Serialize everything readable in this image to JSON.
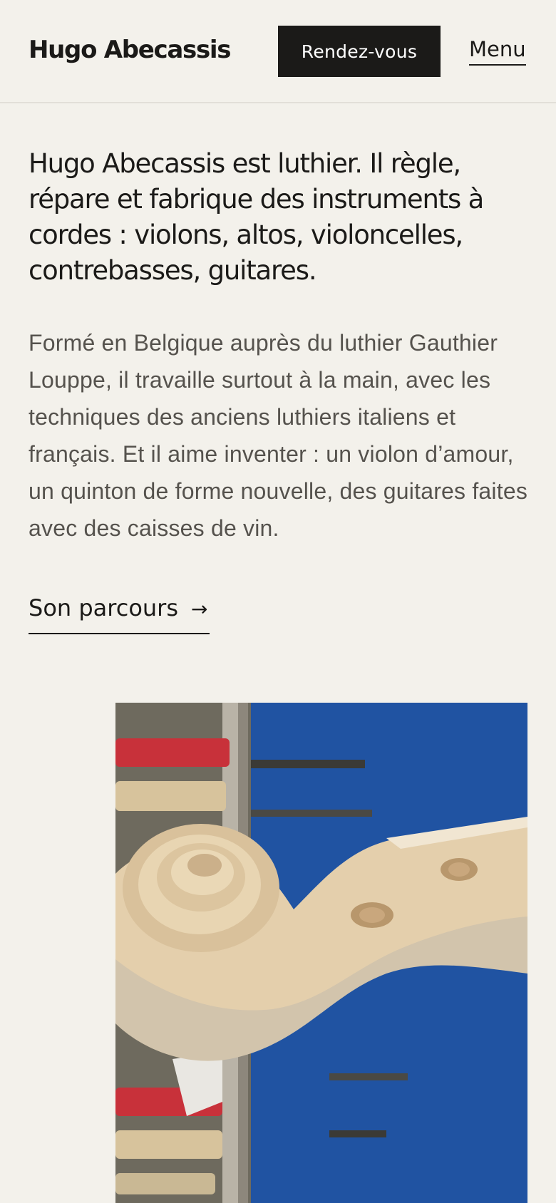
{
  "header": {
    "brand": "Hugo Abecassis",
    "cta_label": "Rendez-vous",
    "menu_label": "Menu"
  },
  "main": {
    "intro": "Hugo Abecassis est luthier. Il règle, répare et fabrique des instruments à cordes : violons, altos, violoncelles, contrebasses, guitares.",
    "description": "Formé en Belgique auprès du luthier Gauthier Louppe, il travaille surtout à la main, avec les techniques des anciens luthiers italiens et français. Et il aime inventer : un violon d’amour, un quinton de forme nouvelle, des guitares faites avec des caisses de vin.",
    "parcours_link": "Son parcours",
    "parcours_arrow": "→"
  },
  "colors": {
    "background": "#f3f1eb",
    "text": "#1b1a18",
    "muted_text": "#55524d",
    "button_bg": "#1b1a18",
    "button_text": "#ffffff"
  }
}
